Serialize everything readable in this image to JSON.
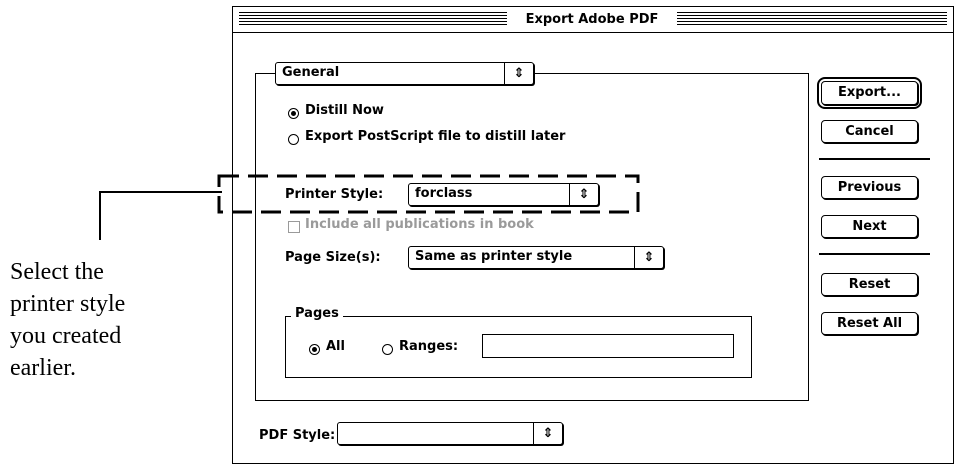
{
  "callout": {
    "lines": [
      "Select the",
      "printer style",
      "you created",
      "earlier."
    ]
  },
  "dialog": {
    "title": "Export Adobe PDF",
    "section_popup": "General",
    "popup_arrow_glyph": "⇕",
    "distill_options": [
      {
        "label": "Distill Now",
        "selected": true
      },
      {
        "label": "Export PostScript file to distill later",
        "selected": false
      }
    ],
    "printer_style": {
      "label": "Printer Style:",
      "value": "forclass"
    },
    "include_all": {
      "label": "Include all publications in book",
      "checked": false,
      "enabled": false
    },
    "page_size": {
      "label": "Page Size(s):",
      "value": "Same as printer style"
    },
    "pages": {
      "legend": "Pages",
      "options": [
        {
          "label": "All",
          "selected": true
        },
        {
          "label": "Ranges:",
          "selected": false
        }
      ],
      "range_value": ""
    },
    "pdf_style": {
      "label": "PDF Style:",
      "value": ""
    },
    "buttons": {
      "export": "Export...",
      "cancel": "Cancel",
      "previous": "Previous",
      "next": "Next",
      "reset": "Reset",
      "reset_all": "Reset All"
    }
  }
}
